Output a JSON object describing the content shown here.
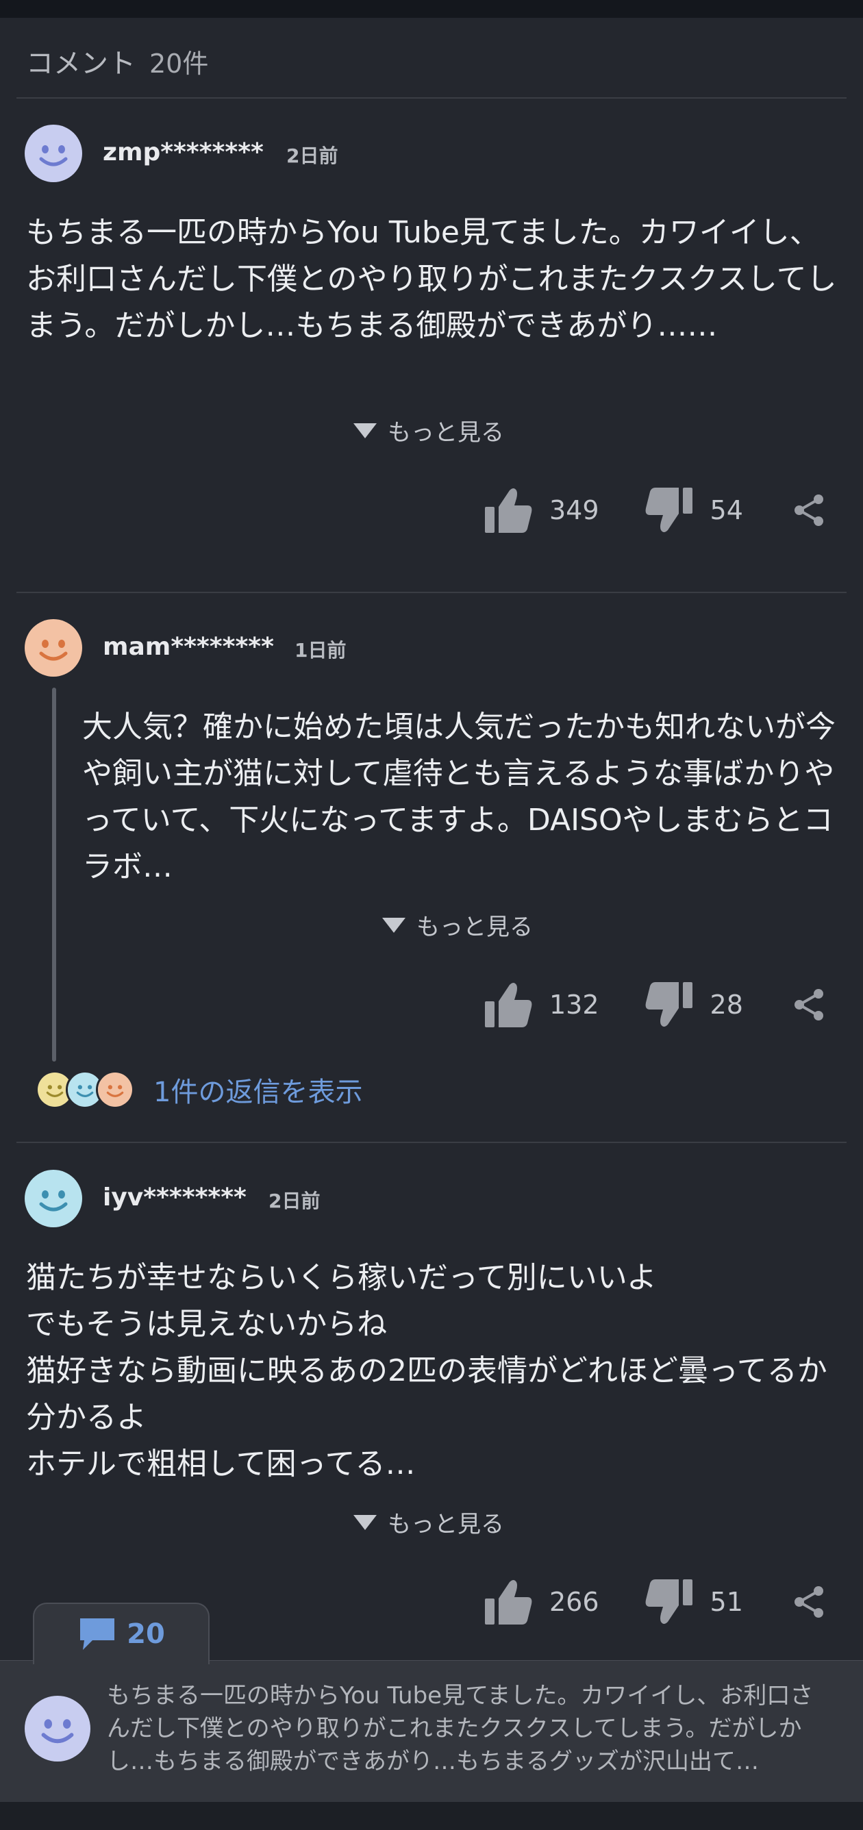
{
  "header": {
    "title": "コメント",
    "count": "20件"
  },
  "comments": [
    {
      "user": "zmp********",
      "time": "2日前",
      "text": "もちまる一匹の時からYou Tube見てました。カワイイし、お利口さんだし下僕とのやり取りがこれまたクスクスしてしまう。だがしかし…もちまる御殿ができあがり……",
      "more_label": "もっと見る",
      "likes": "349",
      "dislikes": "54",
      "avatar_color": "#c8cdf0"
    },
    {
      "user": "mam********",
      "time": "1日前",
      "text": "大人気？確かに始めた頃は人気だったかも知れないが今や飼い主が猫に対して虐待とも言えるような事ばかりやっていて、下火になってますよ。DAISOやしまむらとコラボ…",
      "more_label": "もっと見る",
      "likes": "132",
      "dislikes": "28",
      "reply_label": "1件の返信を表示",
      "avatar_color": "#f3c2a4"
    },
    {
      "user": "iyv********",
      "time": "2日前",
      "text": "猫たちが幸せならいくら稼いだって別にいいよ\nでもそうは見えないからね\n猫好きなら動画に映るあの2匹の表情がどれほど曇ってるか分かるよ\nホテルで粗相して困ってる…",
      "more_label": "もっと見る",
      "likes": "266",
      "dislikes": "51",
      "avatar_color": "#b8e3ef"
    }
  ],
  "bottom": {
    "comment_count": "20",
    "preview": "もちまる一匹の時からYou Tube見てました。カワイイし、お利口さんだし下僕とのやり取りがこれまたクスクスしてしまう。だがしかし…もちまる御殿ができあがり…もちまるグッズが沢山出て…"
  },
  "icons": [
    "thumbs-up-icon",
    "thumbs-down-icon",
    "share-icon",
    "chat-bubble-icon",
    "smiley-avatar-icon"
  ],
  "colors": {
    "background": "#24272e",
    "accent": "#6e9bdc",
    "icon_gray": "#9a9da4"
  }
}
